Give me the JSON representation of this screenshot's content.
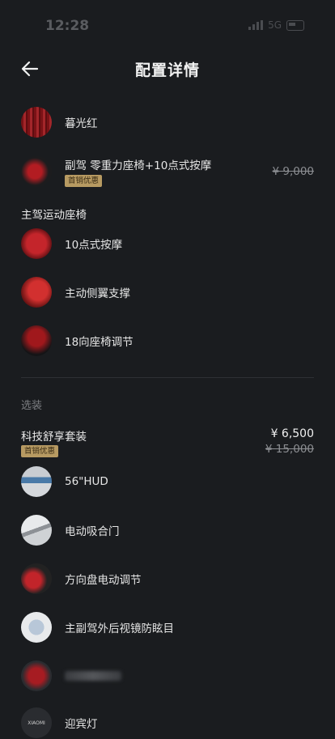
{
  "status": {
    "time": "12:28",
    "network": "5G"
  },
  "header": {
    "title": "配置详情"
  },
  "color_item": {
    "label": "暮光红"
  },
  "passenger_seat": {
    "label": "副驾 零重力座椅+10点式按摩",
    "badge": "首销优惠",
    "old_price": "¥ 9,000"
  },
  "driver_section": {
    "title": "主驾运动座椅"
  },
  "driver_items": [
    {
      "label": "10点式按摩"
    },
    {
      "label": "主动侧翼支撑"
    },
    {
      "label": "18向座椅调节"
    }
  ],
  "optional_section": {
    "title": "选装"
  },
  "tech_pack": {
    "title": "科技舒享套装",
    "badge": "首销优惠",
    "price": "¥ 6,500",
    "old_price": "¥ 15,000"
  },
  "tech_items": [
    {
      "label": "56\"HUD"
    },
    {
      "label": "电动吸合门"
    },
    {
      "label": "方向盘电动调节"
    },
    {
      "label": "主副驾外后视镜防眩目"
    },
    {
      "label": ""
    },
    {
      "label": "迎宾灯",
      "logo_text": "XIAOMI"
    }
  ]
}
